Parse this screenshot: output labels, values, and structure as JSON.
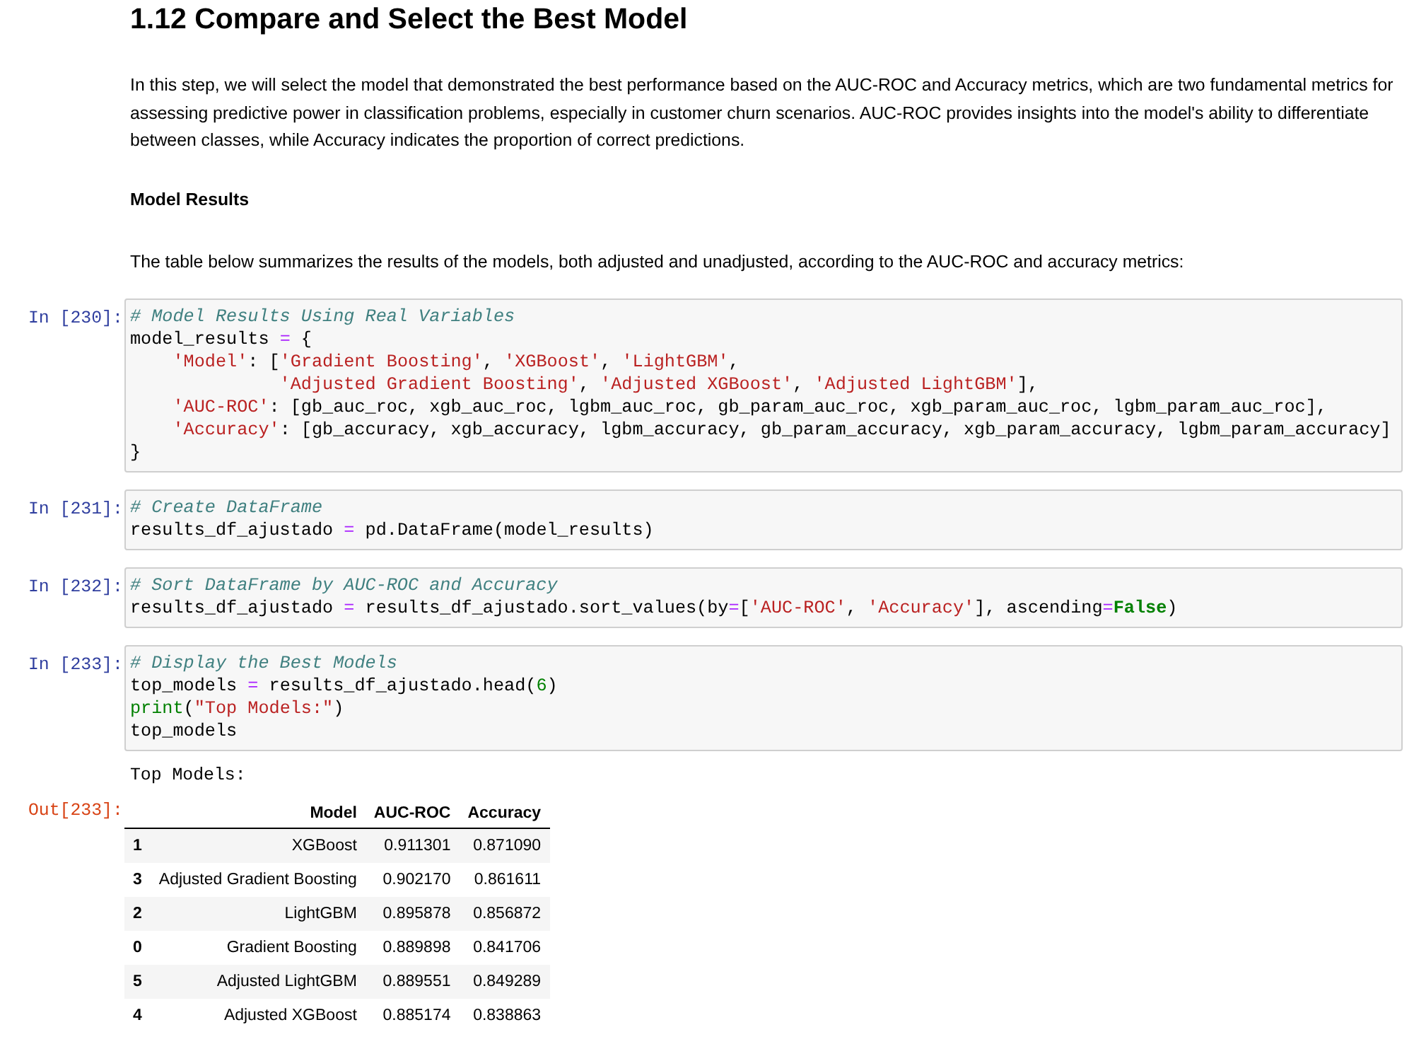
{
  "heading": {
    "number": "1.12",
    "title": "Compare and Select the Best Model"
  },
  "intro": "In this step, we will select the model that demonstrated the best performance based on the AUC-ROC and Accuracy metrics, which are two fundamental metrics for assessing predictive power in classification problems, especially in customer churn scenarios. AUC-ROC provides insights into the model's ability to differentiate between classes, while Accuracy indicates the proportion of correct predictions.",
  "subheading": "Model Results",
  "summary": "The table below summarizes the results of the models, both adjusted and unadjusted, according to the AUC-ROC and accuracy metrics:",
  "cells": [
    {
      "prompt": "In [230]:",
      "lines": [
        [
          {
            "kind": "comment",
            "text": "# Model Results Using Real Variables"
          }
        ],
        [
          {
            "kind": "name",
            "text": "model_results "
          },
          {
            "kind": "op",
            "text": "="
          },
          {
            "kind": "name",
            "text": " {"
          }
        ],
        [
          {
            "kind": "str",
            "text": "    'Model'"
          },
          {
            "kind": "name",
            "text": ": ["
          },
          {
            "kind": "str",
            "text": "'Gradient Boosting'"
          },
          {
            "kind": "name",
            "text": ", "
          },
          {
            "kind": "str",
            "text": "'XGBoost'"
          },
          {
            "kind": "name",
            "text": ", "
          },
          {
            "kind": "str",
            "text": "'LightGBM'"
          },
          {
            "kind": "name",
            "text": ","
          }
        ],
        [
          {
            "kind": "str",
            "text": "              'Adjusted Gradient Boosting'"
          },
          {
            "kind": "name",
            "text": ", "
          },
          {
            "kind": "str",
            "text": "'Adjusted XGBoost'"
          },
          {
            "kind": "name",
            "text": ", "
          },
          {
            "kind": "str",
            "text": "'Adjusted LightGBM'"
          },
          {
            "kind": "name",
            "text": "],"
          }
        ],
        [
          {
            "kind": "str",
            "text": "    'AUC-ROC'"
          },
          {
            "kind": "name",
            "text": ": [gb_auc_roc, xgb_auc_roc, lgbm_auc_roc, gb_param_auc_roc, xgb_param_auc_roc, lgbm_param_auc_roc],"
          }
        ],
        [
          {
            "kind": "str",
            "text": "    'Accuracy'"
          },
          {
            "kind": "name",
            "text": ": [gb_accuracy, xgb_accuracy, lgbm_accuracy, gb_param_accuracy, xgb_param_accuracy, lgbm_param_accuracy]"
          }
        ],
        [
          {
            "kind": "name",
            "text": "}"
          }
        ]
      ]
    },
    {
      "prompt": "In [231]:",
      "lines": [
        [
          {
            "kind": "comment",
            "text": "# Create DataFrame"
          }
        ],
        [
          {
            "kind": "name",
            "text": "results_df_ajustado "
          },
          {
            "kind": "op",
            "text": "="
          },
          {
            "kind": "name",
            "text": " pd.DataFrame(model_results)"
          }
        ]
      ]
    },
    {
      "prompt": "In [232]:",
      "lines": [
        [
          {
            "kind": "comment",
            "text": "# Sort DataFrame by AUC-ROC and Accuracy"
          }
        ],
        [
          {
            "kind": "name",
            "text": "results_df_ajustado "
          },
          {
            "kind": "op",
            "text": "="
          },
          {
            "kind": "name",
            "text": " results_df_ajustado.sort_values(by"
          },
          {
            "kind": "op",
            "text": "="
          },
          {
            "kind": "name",
            "text": "["
          },
          {
            "kind": "str",
            "text": "'AUC-ROC'"
          },
          {
            "kind": "name",
            "text": ", "
          },
          {
            "kind": "str",
            "text": "'Accuracy'"
          },
          {
            "kind": "name",
            "text": "], ascending"
          },
          {
            "kind": "op",
            "text": "="
          },
          {
            "kind": "keyword",
            "text": "False"
          },
          {
            "kind": "name",
            "text": ")"
          }
        ]
      ]
    },
    {
      "prompt": "In [233]:",
      "lines": [
        [
          {
            "kind": "comment",
            "text": "# Display the Best Models"
          }
        ],
        [
          {
            "kind": "name",
            "text": "top_models "
          },
          {
            "kind": "op",
            "text": "="
          },
          {
            "kind": "name",
            "text": " results_df_ajustado.head("
          },
          {
            "kind": "num",
            "text": "6"
          },
          {
            "kind": "name",
            "text": ")"
          }
        ],
        [
          {
            "kind": "builtin",
            "text": "print"
          },
          {
            "kind": "name",
            "text": "("
          },
          {
            "kind": "str",
            "text": "\"Top Models:\""
          },
          {
            "kind": "name",
            "text": ")"
          }
        ],
        [
          {
            "kind": "name",
            "text": "top_models"
          }
        ]
      ]
    }
  ],
  "stdout": "Top Models:",
  "output": {
    "prompt": "Out[233]:",
    "columns": [
      "Model",
      "AUC-ROC",
      "Accuracy"
    ],
    "rows": [
      {
        "index": "1",
        "model": "XGBoost",
        "auc": "0.911301",
        "accuracy": "0.871090"
      },
      {
        "index": "3",
        "model": "Adjusted Gradient Boosting",
        "auc": "0.902170",
        "accuracy": "0.861611"
      },
      {
        "index": "2",
        "model": "LightGBM",
        "auc": "0.895878",
        "accuracy": "0.856872"
      },
      {
        "index": "0",
        "model": "Gradient Boosting",
        "auc": "0.889898",
        "accuracy": "0.841706"
      },
      {
        "index": "5",
        "model": "Adjusted LightGBM",
        "auc": "0.889551",
        "accuracy": "0.849289"
      },
      {
        "index": "4",
        "model": "Adjusted XGBoost",
        "auc": "0.885174",
        "accuracy": "0.838863"
      }
    ]
  }
}
